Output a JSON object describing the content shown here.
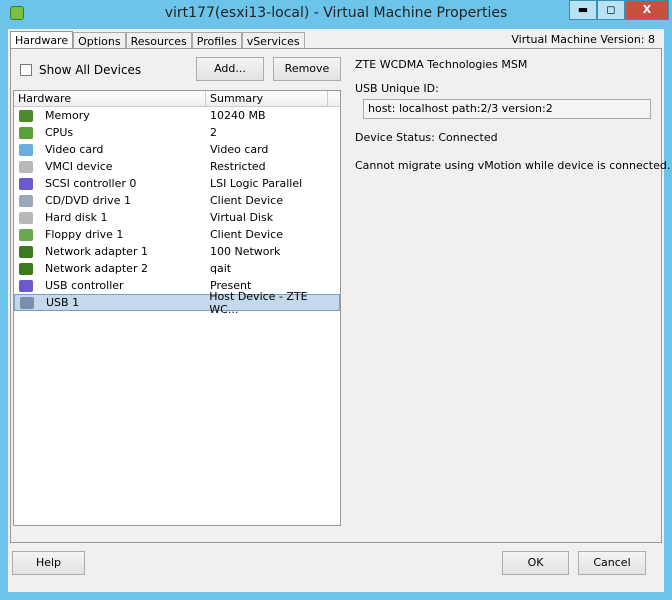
{
  "window": {
    "title": "virt177(esxi13-local) - Virtual Machine Properties",
    "minimize": "▬",
    "maximize": "◻",
    "close": "X"
  },
  "tabs": [
    "Hardware",
    "Options",
    "Resources",
    "Profiles",
    "vServices"
  ],
  "version": "Virtual Machine Version: 8",
  "show_all": "Show All Devices",
  "add": "Add...",
  "remove": "Remove",
  "columns": [
    "Hardware",
    "Summary"
  ],
  "rows": [
    {
      "name": "Memory",
      "summary": "10240 MB",
      "icon": "memory-icon",
      "color": "#4a8a2a"
    },
    {
      "name": "CPUs",
      "summary": "2",
      "icon": "cpu-icon",
      "color": "#5aa03a"
    },
    {
      "name": "Video card",
      "summary": "Video card",
      "icon": "monitor-icon",
      "color": "#6aaee0"
    },
    {
      "name": "VMCI device",
      "summary": "Restricted",
      "icon": "vmci-icon",
      "color": "#b8b8b8"
    },
    {
      "name": "SCSI controller 0",
      "summary": "LSI Logic Parallel",
      "icon": "scsi-icon",
      "color": "#6a5acd"
    },
    {
      "name": "CD/DVD drive 1",
      "summary": "Client Device",
      "icon": "cd-icon",
      "color": "#9aa8b8"
    },
    {
      "name": "Hard disk 1",
      "summary": "Virtual Disk",
      "icon": "disk-icon",
      "color": "#b8b8b8"
    },
    {
      "name": "Floppy drive 1",
      "summary": "Client Device",
      "icon": "floppy-icon",
      "color": "#6aa84f"
    },
    {
      "name": "Network adapter 1",
      "summary": "100 Network",
      "icon": "network-icon",
      "color": "#3d7a1f"
    },
    {
      "name": "Network adapter 2",
      "summary": "qait",
      "icon": "network-icon",
      "color": "#3d7a1f"
    },
    {
      "name": "USB controller",
      "summary": "Present",
      "icon": "usb-controller-icon",
      "color": "#6a5acd"
    },
    {
      "name": "USB 1",
      "summary": "Host Device - ZTE WC...",
      "icon": "usb-icon",
      "color": "#7a8fb0"
    }
  ],
  "selected_index": 11,
  "detail": {
    "device": "ZTE WCDMA Technologies MSM",
    "uid_label": "USB Unique ID:",
    "uid": "host: localhost path:2/3 version:2",
    "status": "Device Status: Connected",
    "note": "Cannot migrate using vMotion while device is connected."
  },
  "footer": {
    "help": "Help",
    "ok": "OK",
    "cancel": "Cancel"
  }
}
